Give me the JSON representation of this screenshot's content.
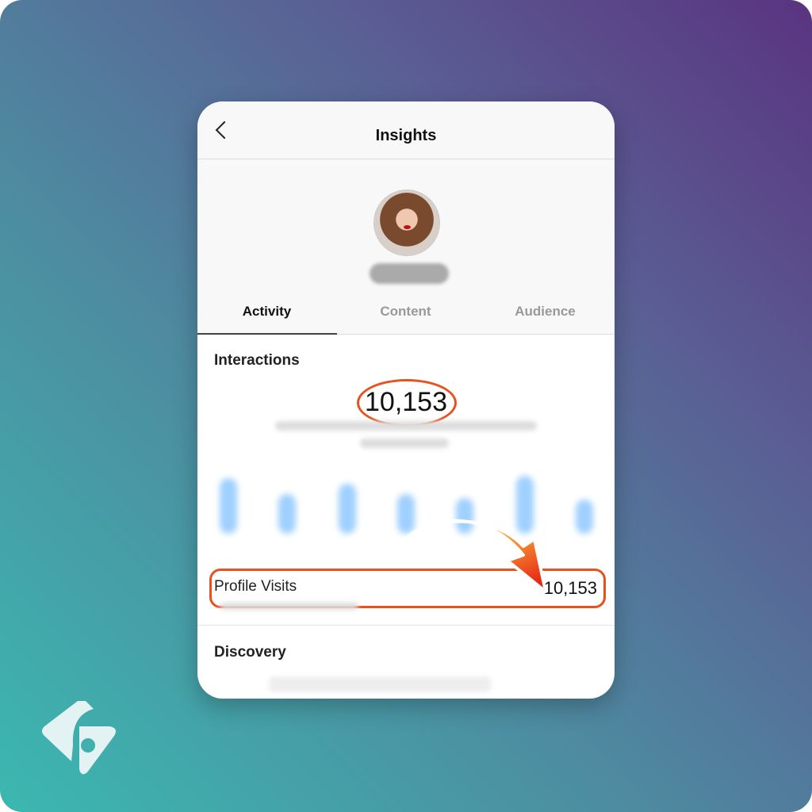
{
  "header": {
    "title": "Insights",
    "back_icon": "chevron-left-icon"
  },
  "tabs": [
    {
      "label": "Activity",
      "active": true
    },
    {
      "label": "Content",
      "active": false
    },
    {
      "label": "Audience",
      "active": false
    }
  ],
  "interactions": {
    "heading": "Interactions",
    "total": "10,153"
  },
  "profile_visits": {
    "label": "Profile Visits",
    "value": "10,153"
  },
  "discovery": {
    "heading": "Discovery"
  },
  "colors": {
    "highlight": "#e8501e",
    "bar": "#9fd0ff",
    "arrow_start": "#ffb940",
    "arrow_end": "#e0100e"
  }
}
